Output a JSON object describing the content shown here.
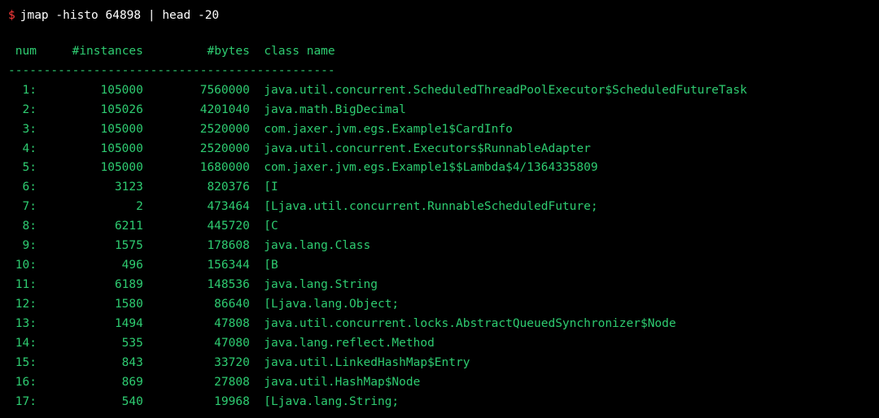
{
  "prompt": "$",
  "command": "jmap -histo 64898 | head -20",
  "headers": {
    "num": "num",
    "instances": "#instances",
    "bytes": "#bytes",
    "class_name": "class name"
  },
  "divider": "----------------------------------------------",
  "rows": [
    {
      "num": "1:",
      "instances": "105000",
      "bytes": "7560000",
      "class_name": "java.util.concurrent.ScheduledThreadPoolExecutor$ScheduledFutureTask"
    },
    {
      "num": "2:",
      "instances": "105026",
      "bytes": "4201040",
      "class_name": "java.math.BigDecimal"
    },
    {
      "num": "3:",
      "instances": "105000",
      "bytes": "2520000",
      "class_name": "com.jaxer.jvm.egs.Example1$CardInfo"
    },
    {
      "num": "4:",
      "instances": "105000",
      "bytes": "2520000",
      "class_name": "java.util.concurrent.Executors$RunnableAdapter"
    },
    {
      "num": "5:",
      "instances": "105000",
      "bytes": "1680000",
      "class_name": "com.jaxer.jvm.egs.Example1$$Lambda$4/1364335809"
    },
    {
      "num": "6:",
      "instances": "3123",
      "bytes": "820376",
      "class_name": "[I"
    },
    {
      "num": "7:",
      "instances": "2",
      "bytes": "473464",
      "class_name": "[Ljava.util.concurrent.RunnableScheduledFuture;"
    },
    {
      "num": "8:",
      "instances": "6211",
      "bytes": "445720",
      "class_name": "[C"
    },
    {
      "num": "9:",
      "instances": "1575",
      "bytes": "178608",
      "class_name": "java.lang.Class"
    },
    {
      "num": "10:",
      "instances": "496",
      "bytes": "156344",
      "class_name": "[B"
    },
    {
      "num": "11:",
      "instances": "6189",
      "bytes": "148536",
      "class_name": "java.lang.String"
    },
    {
      "num": "12:",
      "instances": "1580",
      "bytes": "86640",
      "class_name": "[Ljava.lang.Object;"
    },
    {
      "num": "13:",
      "instances": "1494",
      "bytes": "47808",
      "class_name": "java.util.concurrent.locks.AbstractQueuedSynchronizer$Node"
    },
    {
      "num": "14:",
      "instances": "535",
      "bytes": "47080",
      "class_name": "java.lang.reflect.Method"
    },
    {
      "num": "15:",
      "instances": "843",
      "bytes": "33720",
      "class_name": "java.util.LinkedHashMap$Entry"
    },
    {
      "num": "16:",
      "instances": "869",
      "bytes": "27808",
      "class_name": "java.util.HashMap$Node"
    },
    {
      "num": "17:",
      "instances": "540",
      "bytes": "19968",
      "class_name": "[Ljava.lang.String;"
    }
  ]
}
